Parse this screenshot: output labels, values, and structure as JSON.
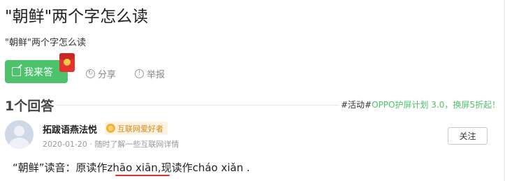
{
  "question": {
    "title": "\"朝鲜\"两个字怎么读",
    "description": "\"朝鲜\"两个字怎么读"
  },
  "actions": {
    "answer_label": "我来答",
    "share_label": "分享",
    "report_label": "举报"
  },
  "answers": {
    "count_label": "1个回答"
  },
  "promo": {
    "tag": "#活动#",
    "text": "OPPO护屏计划 3.0，换屏5折起！"
  },
  "answer": {
    "username": "拓跋语燕法悦",
    "badge": "互联网爱好者",
    "date": "2020-01-20",
    "meta_sep": "·",
    "meta_text": "随时了解一些互联网详情",
    "follow_label": "关注",
    "content": "“朝鲜”读音：原读作zhāo xiān,现读作cháo xiǎn ."
  },
  "colors": {
    "accent_green": "#4cc36b",
    "underline_red": "#e0322d",
    "badge_bg": "#fdf1df",
    "badge_text": "#d98a1c"
  }
}
